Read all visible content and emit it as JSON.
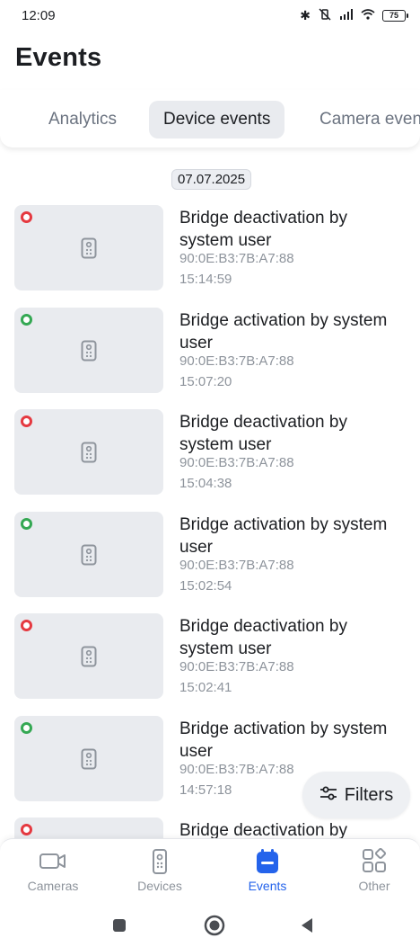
{
  "status": {
    "time": "12:09",
    "battery": "75"
  },
  "page": {
    "title": "Events"
  },
  "tabs": [
    {
      "label": "Analytics",
      "active": false
    },
    {
      "label": "Device events",
      "active": true
    },
    {
      "label": "Camera events",
      "active": false
    }
  ],
  "date_chip": "07.07.2025",
  "events": [
    {
      "title": "Bridge deactivation by system user",
      "mac": "90:0E:B3:7B:A7:88",
      "time": "15:14:59",
      "status": "red"
    },
    {
      "title": "Bridge activation by system user",
      "mac": "90:0E:B3:7B:A7:88",
      "time": "15:07:20",
      "status": "green"
    },
    {
      "title": "Bridge deactivation by system user",
      "mac": "90:0E:B3:7B:A7:88",
      "time": "15:04:38",
      "status": "red"
    },
    {
      "title": "Bridge activation by system user",
      "mac": "90:0E:B3:7B:A7:88",
      "time": "15:02:54",
      "status": "green"
    },
    {
      "title": "Bridge deactivation by system user",
      "mac": "90:0E:B3:7B:A7:88",
      "time": "15:02:41",
      "status": "red"
    },
    {
      "title": "Bridge activation by system user",
      "mac": "90:0E:B3:7B:A7:88",
      "time": "14:57:18",
      "status": "green"
    },
    {
      "title": "Bridge deactivation by",
      "mac": "",
      "time": "",
      "status": "red"
    }
  ],
  "filters_label": "Filters",
  "nav": [
    {
      "label": "Cameras",
      "icon": "camera-icon",
      "active": false
    },
    {
      "label": "Devices",
      "icon": "remote-device-icon",
      "active": false
    },
    {
      "label": "Events",
      "icon": "calendar-icon",
      "active": true
    },
    {
      "label": "Other",
      "icon": "grid-icon",
      "active": false
    }
  ],
  "colors": {
    "accent": "#2463eb",
    "status_red": "#e53940",
    "status_green": "#34a853"
  }
}
